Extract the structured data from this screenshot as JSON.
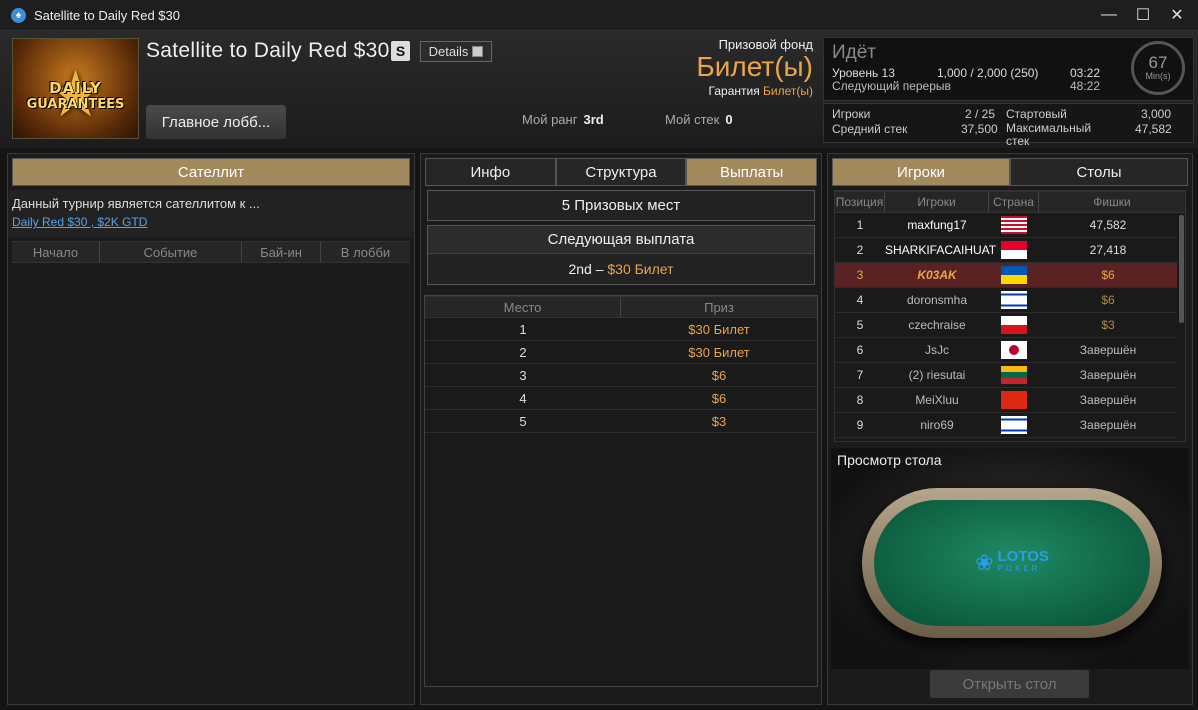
{
  "window": {
    "title": "Satellite to Daily Red $30"
  },
  "header": {
    "logo_text_1": "DAILY",
    "logo_text_2": "GUARANTEES",
    "tournament_name": "Satellite to Daily Red $30",
    "badge": "S",
    "details_label": "Details",
    "lobby_button": "Главное лобб...",
    "prize_pool_label": "Призовой фонд",
    "prize_pool_value": "Билет(ы)",
    "guarantee_label": "Гарантия",
    "guarantee_value": "Билет(ы)",
    "rank_label": "Мой ранг",
    "rank_value": "3rd",
    "stack_label": "Мой стек",
    "stack_value": "0"
  },
  "status": {
    "state": "Идёт",
    "level_label": "Уровень 13",
    "blinds": "1,000 / 2,000 (250)",
    "level_time": "03:22",
    "next_break_label": "Следующий перерыв",
    "next_break_time": "48:22",
    "timer_value": "67",
    "timer_unit": "Min(s)"
  },
  "stats": {
    "players_label": "Игроки",
    "players_value": "2 / 25",
    "starting_label": "Стартовый",
    "starting_value": "3,000",
    "avg_label": "Средний стек",
    "avg_value": "37,500",
    "max_label": "Максимальный стек",
    "max_value": "47,582"
  },
  "left_panel": {
    "tab": "Сателлит",
    "description": "Данный турнир является сателлитом к ...",
    "link": "Daily Red $30 , $2K GTD",
    "columns": [
      "Начало",
      "Событие",
      "Бай-ин",
      "В лобби"
    ]
  },
  "center_panel": {
    "tabs": [
      "Инфо",
      "Структура",
      "Выплаты"
    ],
    "active_tab": "Выплаты",
    "prize_places": "5 Призовых мест",
    "next_payout_label": "Следующая выплата",
    "next_payout_place": "2nd –",
    "next_payout_value": "$30 Билет",
    "columns": [
      "Место",
      "Приз"
    ],
    "payouts": [
      {
        "place": "1",
        "prize": "$30 Билет"
      },
      {
        "place": "2",
        "prize": "$30 Билет"
      },
      {
        "place": "3",
        "prize": "$6"
      },
      {
        "place": "4",
        "prize": "$6"
      },
      {
        "place": "5",
        "prize": "$3"
      }
    ]
  },
  "right_panel": {
    "tabs": [
      "Игроки",
      "Столы"
    ],
    "active_tab": "Игроки",
    "columns": [
      "Позиция",
      "Игроки",
      "Страна",
      "Фишки"
    ],
    "players": [
      {
        "pos": "1",
        "name": "maxfung17",
        "flag": "malaysia-flag",
        "chips": "47,582"
      },
      {
        "pos": "2",
        "name": "SHARKIFACAIHUAT",
        "flag": "singapore-flag",
        "chips": "27,418"
      },
      {
        "pos": "3",
        "name": "K03AK",
        "flag": "ukraine-flag",
        "chips": "$6"
      },
      {
        "pos": "4",
        "name": "doronsmha",
        "flag": "israel-flag",
        "chips": "$6"
      },
      {
        "pos": "5",
        "name": "czechraise",
        "flag": "czech-flag",
        "chips": "$3"
      },
      {
        "pos": "6",
        "name": "JsJc",
        "flag": "japan-flag",
        "chips": "Завершён"
      },
      {
        "pos": "7",
        "name": "(2) riesutai",
        "flag": "lithuania-flag",
        "chips": "Завершён"
      },
      {
        "pos": "8",
        "name": "MeiXluu",
        "flag": "china-flag",
        "chips": "Завершён"
      },
      {
        "pos": "9",
        "name": "niro69",
        "flag": "israel-flag",
        "chips": "Завершён"
      }
    ],
    "table_view_label": "Просмотр стола",
    "table_logo": "LOTOS",
    "table_logo_sub": "POKER",
    "open_table_button": "Открыть стол"
  },
  "colors": {
    "accent": "#a28a5d",
    "gold": "#e9a54a",
    "highlight_row": "#5a2222",
    "link": "#5aa2e6"
  }
}
